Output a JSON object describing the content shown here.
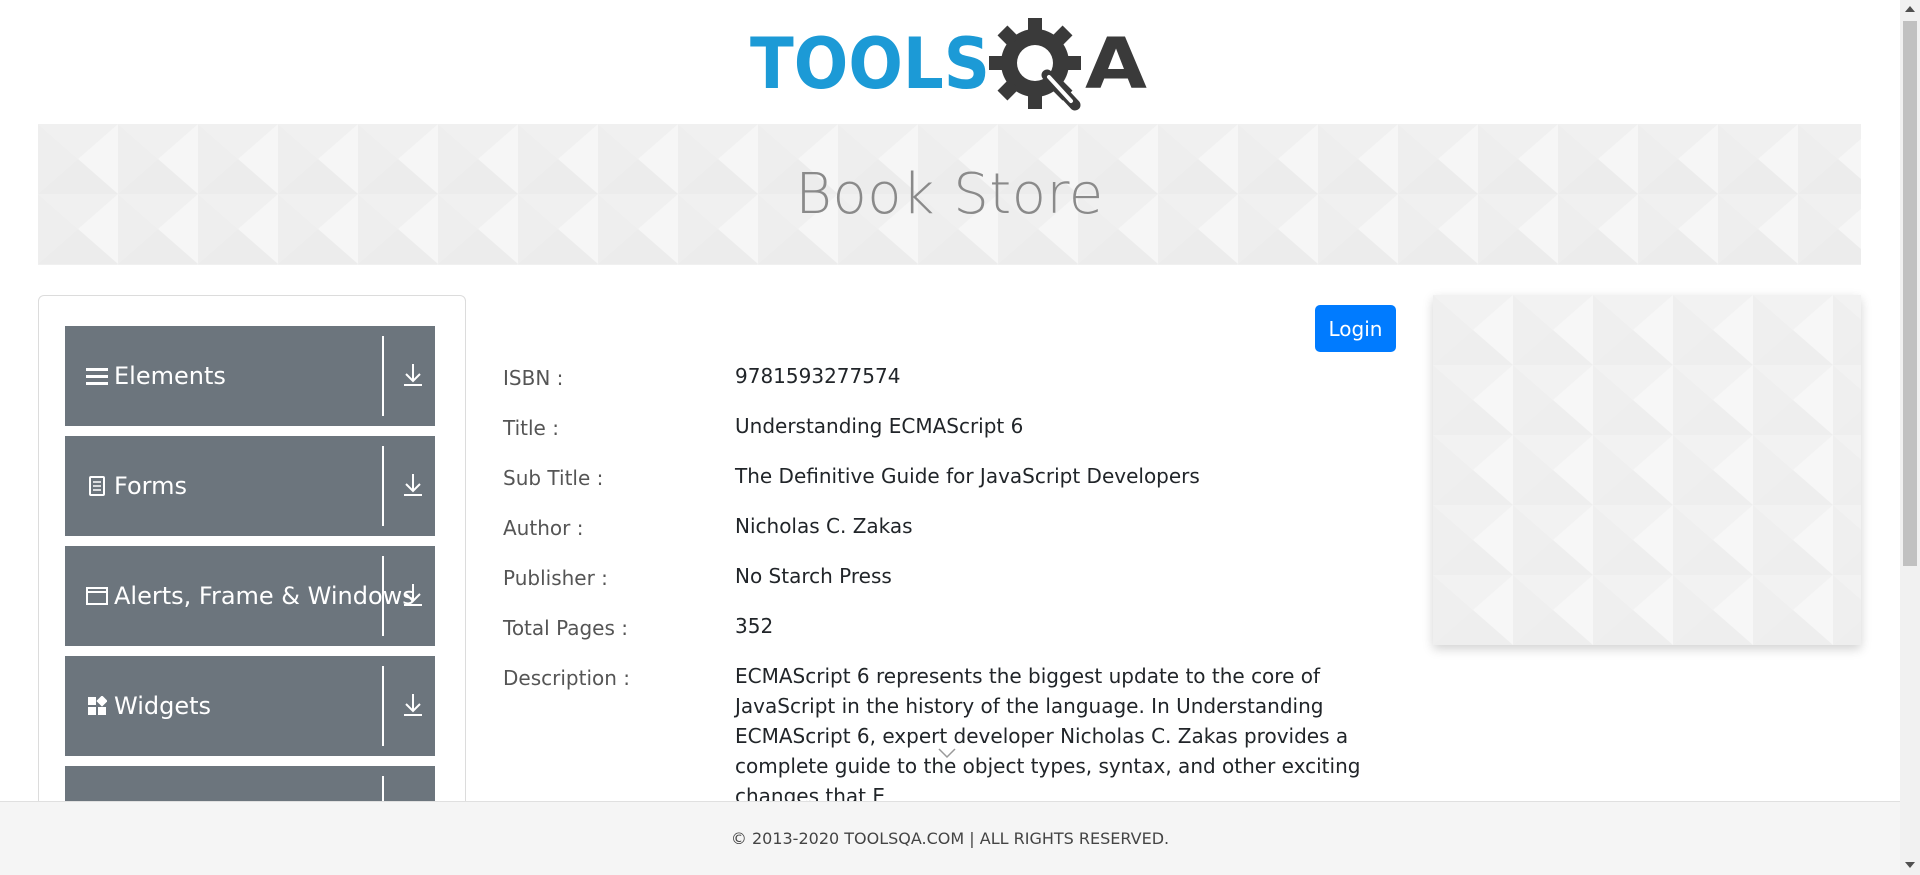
{
  "header": {
    "logo": {
      "text_left": "TOOLS",
      "text_right": "A",
      "brand_blue": "#1c9ad6",
      "brand_dark": "#3a3a3a"
    }
  },
  "banner": {
    "title": "Book Store"
  },
  "sidebar": {
    "groups": [
      {
        "label": "Elements",
        "icon": "hamburger-icon"
      },
      {
        "label": "Forms",
        "icon": "document-icon"
      },
      {
        "label": "Alerts, Frame & Windows",
        "icon": "window-icon"
      },
      {
        "label": "Widgets",
        "icon": "widgets-grid-icon"
      },
      {
        "label": "",
        "icon": ""
      }
    ],
    "group_color": "#6c757d"
  },
  "main": {
    "login_label": "Login",
    "login_color": "#007bff",
    "book": [
      {
        "label": "ISBN :",
        "value": "9781593277574"
      },
      {
        "label": "Title :",
        "value": "Understanding ECMAScript 6"
      },
      {
        "label": "Sub Title :",
        "value": "The Definitive Guide for JavaScript Developers"
      },
      {
        "label": "Author :",
        "value": "Nicholas C. Zakas"
      },
      {
        "label": "Publisher :",
        "value": "No Starch Press"
      },
      {
        "label": "Total Pages :",
        "value": "352"
      },
      {
        "label": "Description :",
        "value": "ECMAScript 6 represents the biggest update to the core of JavaScript in the history of the language. In Understanding ECMAScript 6, expert developer Nicholas C. Zakas provides a complete guide to the object types, syntax, and other exciting changes that E"
      }
    ]
  },
  "footer": {
    "text": "© 2013-2020 TOOLSQA.COM | ALL RIGHTS RESERVED."
  }
}
